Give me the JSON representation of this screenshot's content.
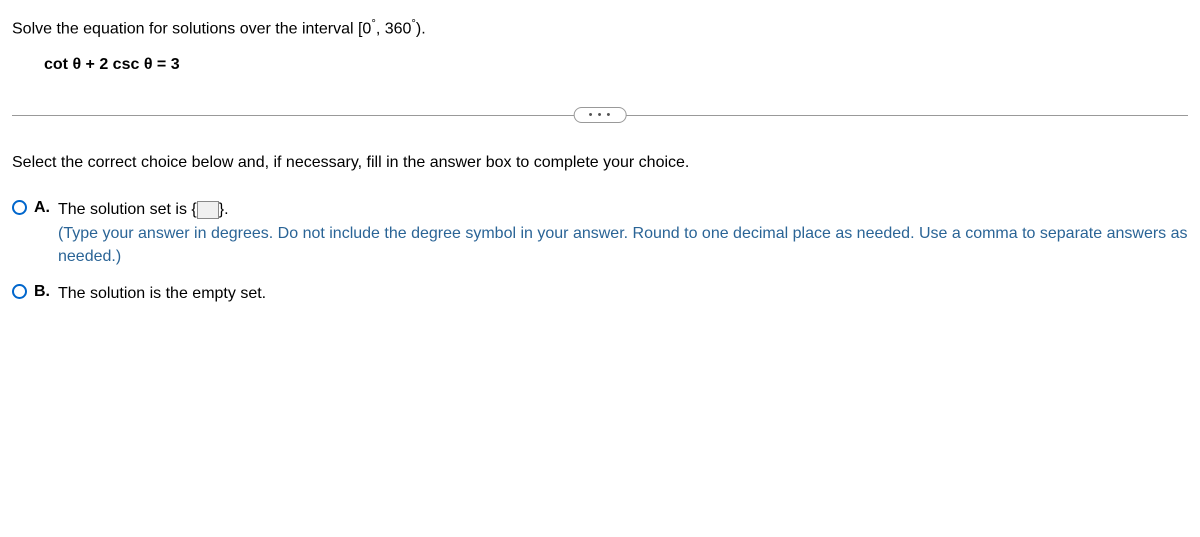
{
  "question": {
    "prompt_prefix": "Solve the equation for solutions over the interval [0",
    "degree_sym": "°",
    "prompt_mid": ", 360",
    "prompt_suffix": ").",
    "equation": "cot θ + 2 csc θ = 3"
  },
  "divider": {
    "dots": "• • •"
  },
  "instruction": "Select the correct choice below and, if necessary, fill in the answer box to complete your choice.",
  "choices": {
    "a": {
      "letter": "A.",
      "text_before": "The solution set is {",
      "text_after": "}.",
      "hint": "(Type your answer in degrees. Do not include the degree symbol in your answer. Round to one decimal place as needed. Use a comma to separate answers as needed.)",
      "input_value": ""
    },
    "b": {
      "letter": "B.",
      "text": "The solution is the empty set."
    }
  }
}
